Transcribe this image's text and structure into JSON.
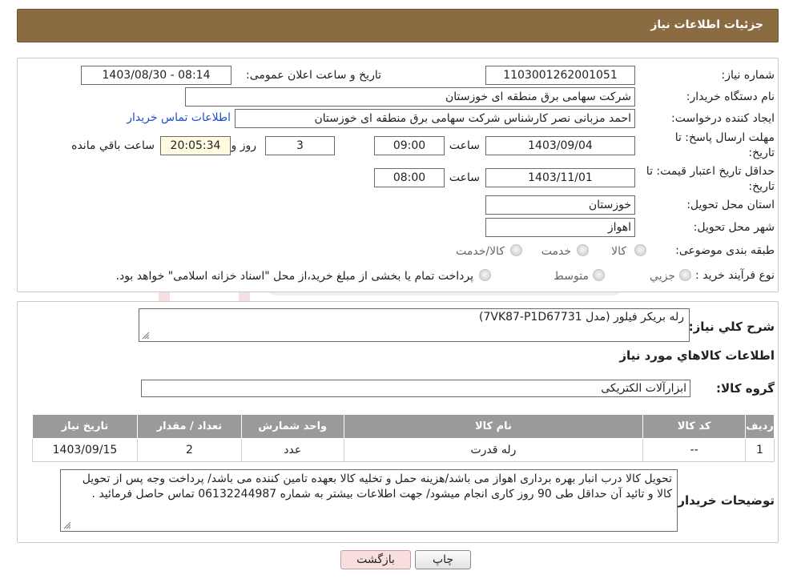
{
  "header": {
    "title": "جزئیات اطلاعات نیاز"
  },
  "form": {
    "need_number": {
      "label": "شماره نیاز:",
      "value": "1103001262001051"
    },
    "announce_datetime": {
      "label": "تاریخ و ساعت اعلان عمومی:",
      "value": "1403/08/30 - 08:14"
    },
    "buyer_org": {
      "label": "نام دستگاه خریدار:",
      "value": "شرکت سهامی برق منطقه ای خوزستان"
    },
    "requester": {
      "label": "ایجاد کننده درخواست:",
      "value": "احمد مزبانی نصر کارشناس شرکت سهامی برق منطقه ای خوزستان",
      "contact_link": "اطلاعات تماس خریدار"
    },
    "reply_deadline": {
      "label_line1": "مهلت ارسال پاسخ: تا",
      "label_line2": "تاریخ:",
      "date": "1403/09/04",
      "time_label": "ساعت",
      "time": "09:00",
      "days": "3",
      "days_label": "روز و",
      "remaining": "20:05:34",
      "remaining_label": "ساعت باقي مانده"
    },
    "price_validity": {
      "label_line1": "حداقل تاریخ اعتبار قیمت: تا",
      "label_line2": "تاریخ:",
      "date": "1403/11/01",
      "time_label": "ساعت",
      "time": "08:00"
    },
    "province": {
      "label": "استان محل تحویل:",
      "value": "خوزستان"
    },
    "city": {
      "label": "شهر محل تحویل:",
      "value": "اهواز"
    },
    "category": {
      "label": "طبقه بندی موضوعی:",
      "options": [
        "کالا",
        "خدمت",
        "کالا/خدمت"
      ]
    },
    "purchase_type": {
      "label": "نوع فرآیند خرید :",
      "options": [
        "جزیي",
        "متوسط"
      ],
      "note": "پرداخت تمام یا بخشی از مبلغ خرید،از محل \"اسناد خزانه اسلامی\" خواهد بود."
    }
  },
  "details": {
    "summary_label": "شرح كلي نياز:",
    "summary_value": "رله بریکر فیلور (مدل 7VK87-P1D67731)",
    "goods_info_title": "اطلاعات كالاهاي مورد نياز",
    "goods_group_label": "گروه کالا:",
    "goods_group_value": "ابزارآلات الکتریکی",
    "table": {
      "headers": [
        "رديف",
        "کد کالا",
        "نام کالا",
        "واحد شمارش",
        "تعداد / مقدار",
        "تاریخ نیاز"
      ],
      "rows": [
        [
          "1",
          "--",
          "رله قدرت",
          "عدد",
          "2",
          "1403/09/15"
        ]
      ]
    },
    "buyer_notes_label": "توضیحات خریدار:",
    "buyer_notes_value": "تحویل کالا درب انبار بهره برداری اهواز می باشد/هزینه حمل و تخلیه کالا بعهده تامین کننده می باشد/ پرداخت وجه پس از تحویل کالا و تائید آن حداقل طی 90 روز کاری انجام میشود/ جهت اطلاعات بیشتر به شماره 06132244987 تماس حاصل فرمائید ."
  },
  "buttons": {
    "print": "چاپ",
    "back": "بازگشت"
  },
  "colors": {
    "header_bg": "#8B6C42",
    "table_header_bg": "#9a9a9a",
    "link": "#1a4fcf",
    "back_button_bg": "#f9dede"
  }
}
